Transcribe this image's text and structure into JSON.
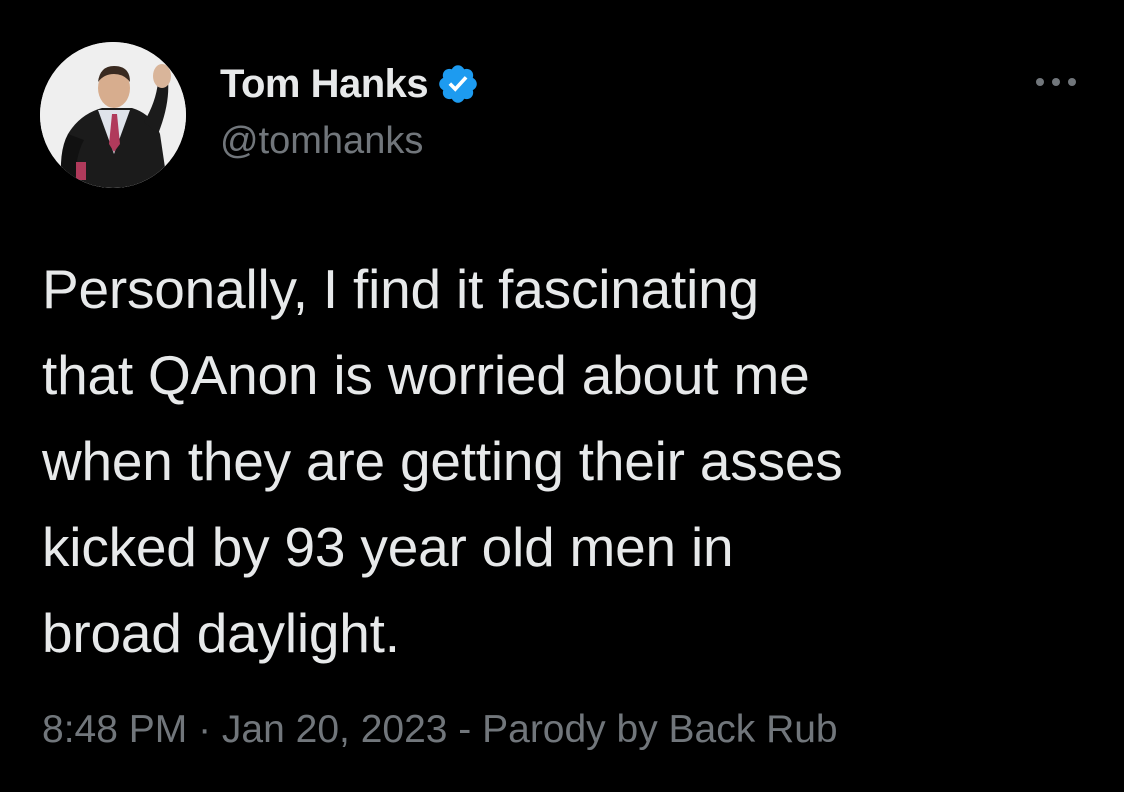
{
  "author": {
    "display_name": "Tom Hanks",
    "handle": "@tomhanks",
    "verified_icon": "verified-badge-icon",
    "avatar": "profile-photo"
  },
  "actions": {
    "more_icon": "more-options-icon"
  },
  "tweet": {
    "text": "Personally, I find it fascinating\nthat QAnon is worried about me\nwhen they are getting their asses\nkicked by 93 year old men in\nbroad daylight.",
    "time": "8:48 PM",
    "separator": " · ",
    "date": "Jan 20, 2023",
    "source": " - Parody by Back Rub"
  },
  "colors": {
    "background": "#000000",
    "primary_text": "#e7e9ea",
    "secondary_text": "#71767b",
    "verified_blue": "#1d9bf0"
  }
}
